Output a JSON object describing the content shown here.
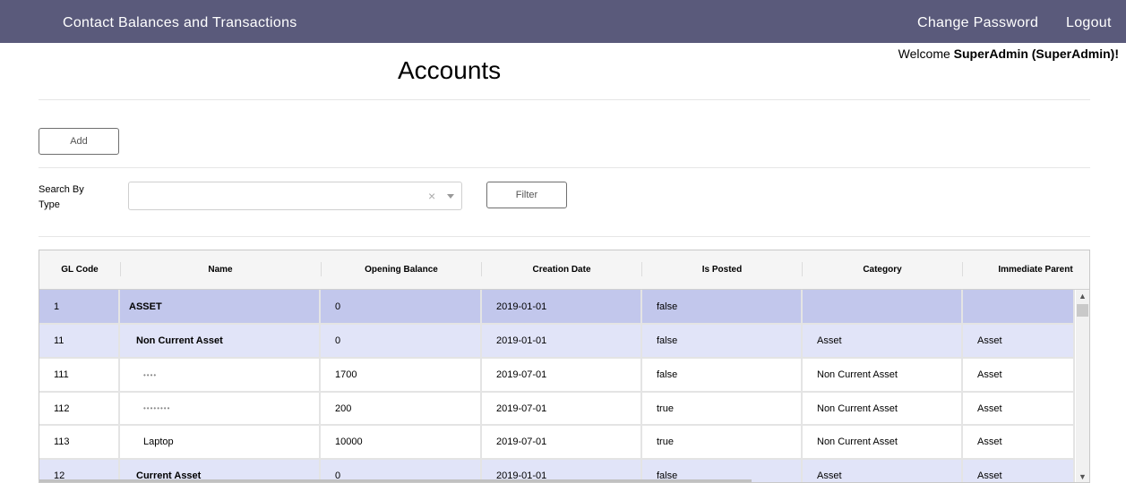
{
  "header": {
    "app_title": "Contact Balances and Transactions",
    "change_password": "Change Password",
    "logout": "Logout"
  },
  "welcome": {
    "prefix": "Welcome",
    "user": "SuperAdmin (SuperAdmin)!"
  },
  "page_title": "Accounts",
  "add_label": "Add",
  "search": {
    "label_line1": "Search By",
    "label_line2": "Type",
    "value": "",
    "clear_icon": "×",
    "filter_label": "Filter"
  },
  "colors": {
    "topbar": "#5a5a7b",
    "row_selected": "#c2c7ec",
    "row_alt": "#e1e4f8"
  },
  "grid": {
    "columns": [
      "GL Code",
      "Name",
      "Opening Balance",
      "Creation Date",
      "Is Posted",
      "Category",
      "Immediate Parent"
    ],
    "rows": [
      [
        "1",
        "ASSET",
        "0",
        "2019-01-01",
        "false",
        "",
        ""
      ],
      [
        "11",
        "Non Current Asset",
        "0",
        "2019-01-01",
        "false",
        "Asset",
        "Asset"
      ],
      [
        "111",
        "••••",
        "1700",
        "2019-07-01",
        "false",
        "Non Current Asset",
        "Asset"
      ],
      [
        "112",
        "••••••••",
        "200",
        "2019-07-01",
        "true",
        "Non Current Asset",
        "Asset"
      ],
      [
        "113",
        "Laptop",
        "10000",
        "2019-07-01",
        "true",
        "Non Current Asset",
        "Asset"
      ],
      [
        "12",
        "Current Asset",
        "0",
        "2019-01-01",
        "false",
        "Asset",
        "Asset"
      ]
    ]
  },
  "icons": {
    "scroll_up": "chevron-up-icon",
    "scroll_down": "chevron-down-icon",
    "dropdown": "caret-down-icon"
  }
}
